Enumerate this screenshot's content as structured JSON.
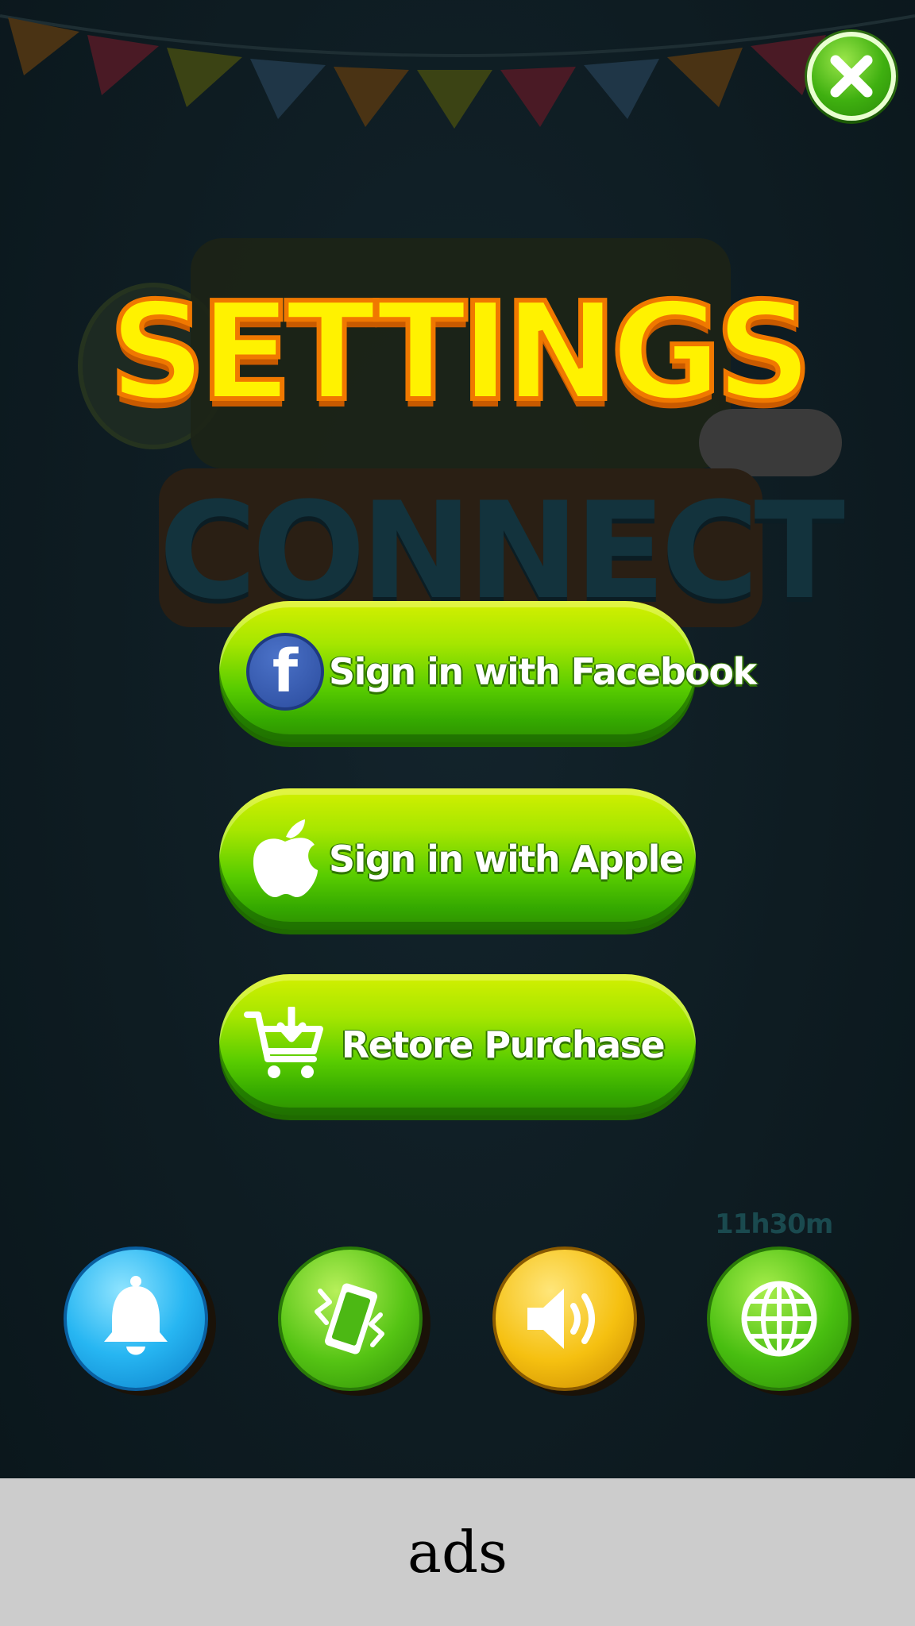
{
  "screen": {
    "title": "SETTINGS",
    "background_logo_word": "CONNECT"
  },
  "buttons": {
    "close": {
      "icon": "close-icon"
    },
    "facebook": {
      "label": "Sign in with Facebook",
      "icon": "facebook-icon",
      "icon_glyph": "f"
    },
    "apple": {
      "label": "Sign in with Apple",
      "icon": "apple-icon"
    },
    "restore": {
      "label": "Retore Purchase",
      "icon": "cart-download-icon"
    }
  },
  "toggles": [
    {
      "name": "notifications",
      "icon": "bell-icon",
      "color": "#27b6f2"
    },
    {
      "name": "vibration",
      "icon": "vibrate-phone-icon",
      "color": "#55c414"
    },
    {
      "name": "sound",
      "icon": "speaker-icon",
      "color": "#f5c010"
    },
    {
      "name": "language",
      "icon": "globe-icon",
      "color": "#48be10"
    }
  ],
  "timer_text": "11h30m",
  "ads": {
    "label": "ads"
  },
  "colors": {
    "title_fill": "#fff200",
    "title_stroke": "#f07800",
    "button_green": "#58cc00",
    "ads_background": "#cccccc"
  }
}
